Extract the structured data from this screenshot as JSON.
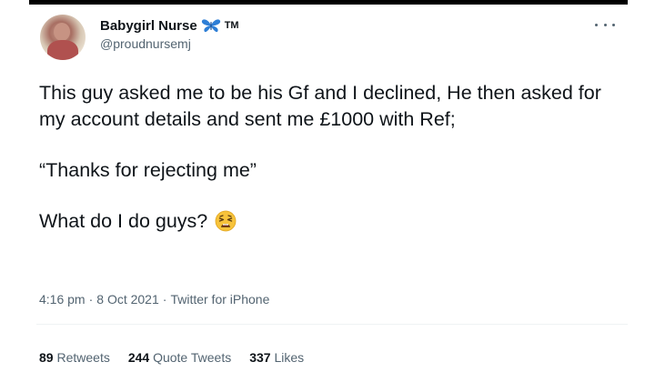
{
  "user": {
    "display_name": "Babygirl Nurse",
    "trademark": "TM",
    "handle": "@proudnursemj"
  },
  "tweet": {
    "line_1": "This guy asked me to be his Gf and I declined, He then asked for my account details and sent me £1000 with Ref;",
    "line_2": "“Thanks for rejecting me”",
    "line_3": "What do I do guys?"
  },
  "meta": {
    "time": "4:16 pm",
    "separator_1": "·",
    "date": "8 Oct 2021",
    "separator_2": "·",
    "source": "Twitter for iPhone"
  },
  "stats": {
    "retweets_count": "89",
    "retweets_label": "Retweets",
    "quotes_count": "244",
    "quotes_label": "Quote Tweets",
    "likes_count": "337",
    "likes_label": "Likes"
  },
  "icons": {
    "name_badge": "butterfly-icon",
    "menu": "more-icon",
    "emoji": "weary-face-icon"
  },
  "colors": {
    "text_primary": "#0f1419",
    "text_secondary": "#536471",
    "butterfly_blue": "#2f7fd6"
  }
}
